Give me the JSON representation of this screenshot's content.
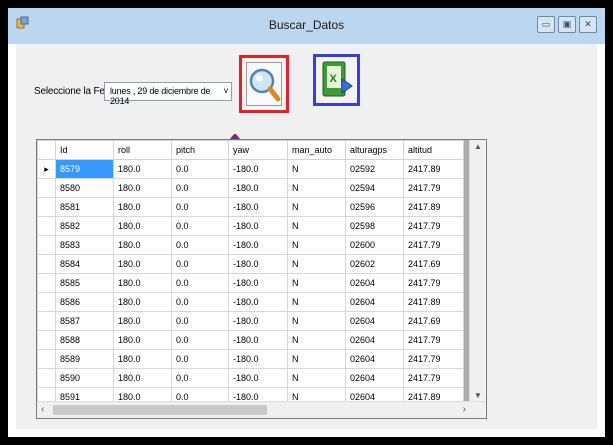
{
  "window": {
    "title": "Buscar_Datos"
  },
  "filter": {
    "label": "Seleccione la Fecha",
    "date_value": "lunes   , 29 de diciembre  de 2014",
    "dropdown_arrow": "v"
  },
  "toolbar": {
    "search_icon": "search-icon",
    "export_icon": "excel-export-icon",
    "arrow_color": "#1e3fd8"
  },
  "grid": {
    "columns": [
      "Id",
      "roll",
      "pitch",
      "yaw",
      "man_auto",
      "alturagps",
      "altitud"
    ],
    "rows": [
      [
        "8579",
        "180.0",
        "0.0",
        "-180.0",
        "N",
        "02592",
        "2417.89"
      ],
      [
        "8580",
        "180.0",
        "0.0",
        "-180.0",
        "N",
        "02594",
        "2417.79"
      ],
      [
        "8581",
        "180.0",
        "0.0",
        "-180.0",
        "N",
        "02596",
        "2417.89"
      ],
      [
        "8582",
        "180.0",
        "0.0",
        "-180.0",
        "N",
        "02598",
        "2417.79"
      ],
      [
        "8583",
        "180.0",
        "0.0",
        "-180.0",
        "N",
        "02600",
        "2417.79"
      ],
      [
        "8584",
        "180.0",
        "0.0",
        "-180.0",
        "N",
        "02602",
        "2417.69"
      ],
      [
        "8585",
        "180.0",
        "0.0",
        "-180.0",
        "N",
        "02604",
        "2417.79"
      ],
      [
        "8586",
        "180.0",
        "0.0",
        "-180.0",
        "N",
        "02604",
        "2417.89"
      ],
      [
        "8587",
        "180.0",
        "0.0",
        "-180.0",
        "N",
        "02604",
        "2417.69"
      ],
      [
        "8588",
        "180.0",
        "0.0",
        "-180.0",
        "N",
        "02604",
        "2417.79"
      ],
      [
        "8589",
        "180.0",
        "0.0",
        "-180.0",
        "N",
        "02604",
        "2417.79"
      ],
      [
        "8590",
        "180.0",
        "0.0",
        "-180.0",
        "N",
        "02604",
        "2417.79"
      ],
      [
        "8591",
        "180.0",
        "0.0",
        "-180.0",
        "N",
        "02604",
        "2417.89"
      ]
    ],
    "selected_row": 0,
    "current_row_marker": "▸"
  },
  "colors": {
    "selection": "#3399ff",
    "search_border": "#e0202a",
    "export_border": "#3c3cd8"
  }
}
